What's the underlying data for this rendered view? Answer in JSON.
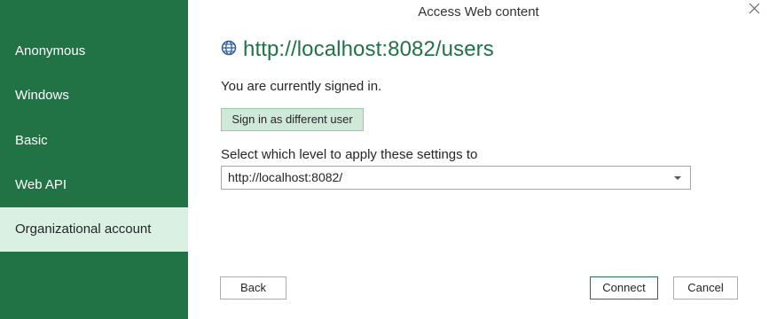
{
  "dialog": {
    "title": "Access Web content"
  },
  "sidebar": {
    "items": [
      {
        "label": "Anonymous"
      },
      {
        "label": "Windows"
      },
      {
        "label": "Basic"
      },
      {
        "label": "Web API"
      },
      {
        "label": "Organizational account",
        "selected": true
      }
    ]
  },
  "main": {
    "url": "http://localhost:8082/users",
    "status_text": "You are currently signed in.",
    "signin_button_label": "Sign in as different user",
    "level_label": "Select which level to apply these settings to",
    "level_selected": "http://localhost:8082/"
  },
  "footer": {
    "back_label": "Back",
    "connect_label": "Connect",
    "cancel_label": "Cancel"
  },
  "colors": {
    "sidebar_bg": "#217346",
    "selected_item_bg": "#d9f0e3",
    "accent": "#217346",
    "signin_button_bg": "#cfe8d8"
  },
  "icons": {
    "url_icon": "globe-icon",
    "close_icon": "close-icon",
    "dropdown_icon": "chevron-down-icon"
  }
}
